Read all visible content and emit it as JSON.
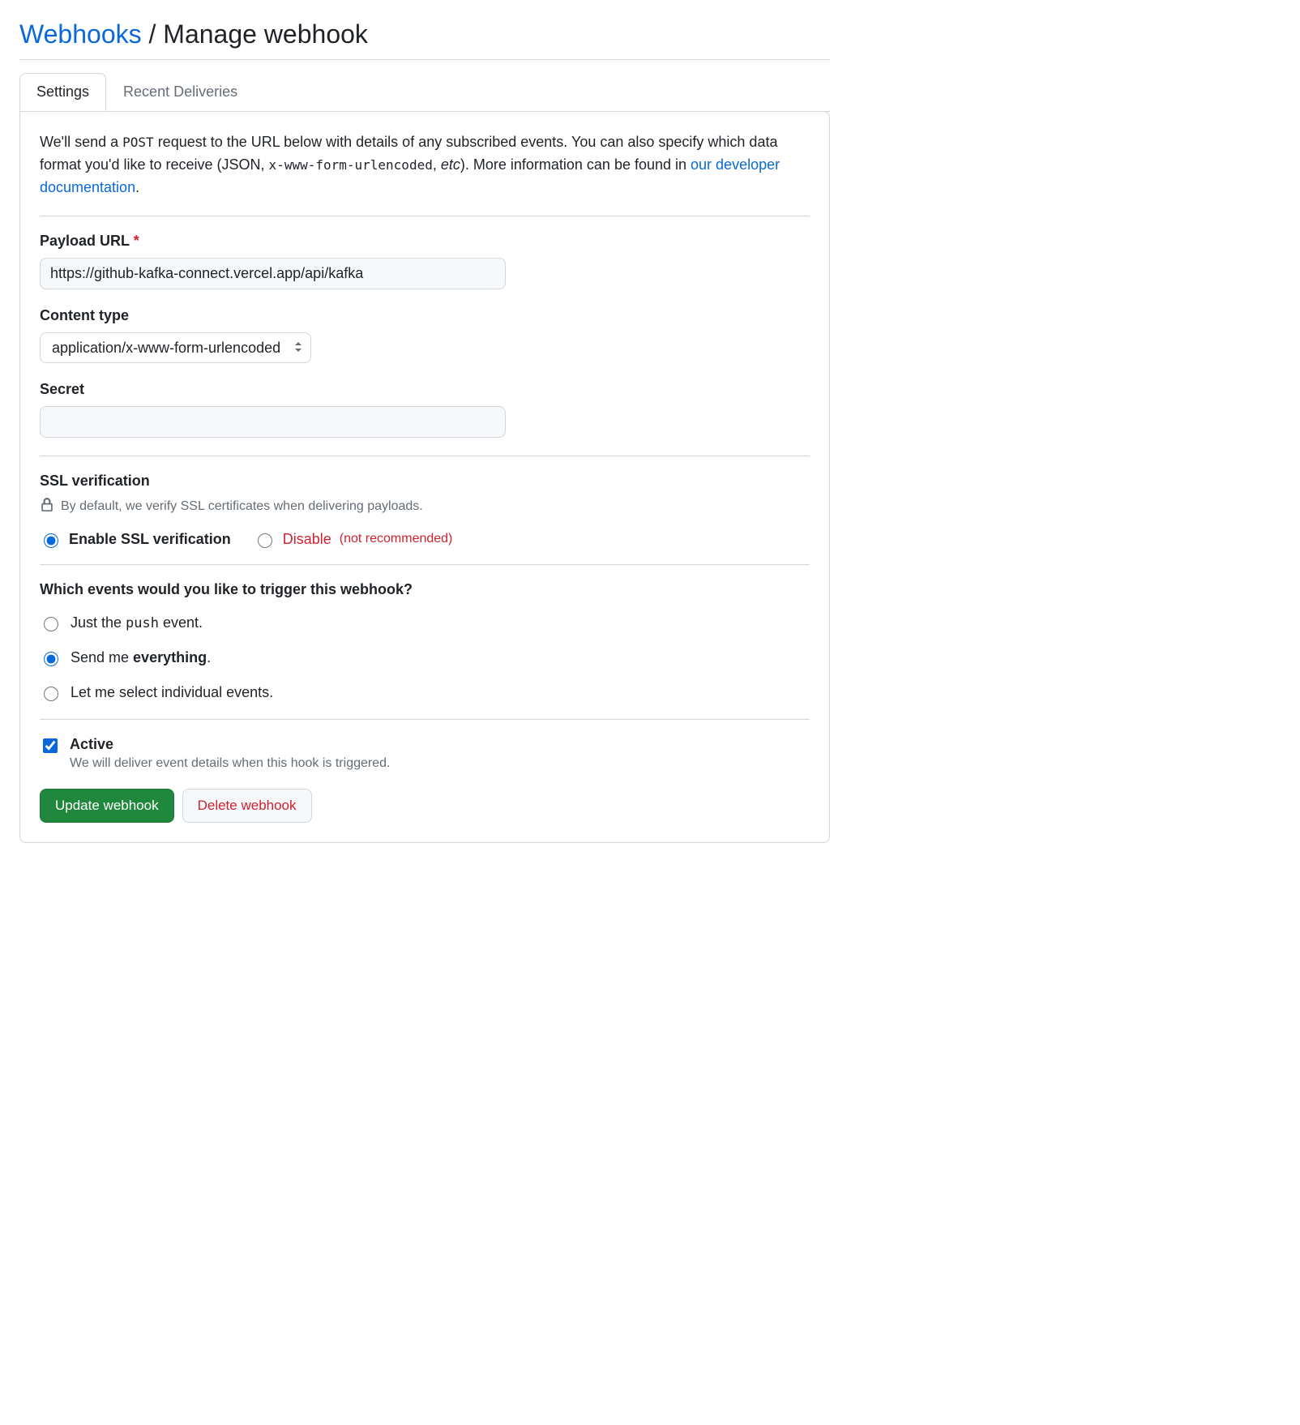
{
  "header": {
    "breadcrumb_link": "Webhooks",
    "separator": " / ",
    "title": "Manage webhook"
  },
  "tabs": {
    "settings": "Settings",
    "deliveries": "Recent Deliveries"
  },
  "intro": {
    "p1a": "We'll send a ",
    "p1_code": "POST",
    "p1b": " request to the URL below with details of any subscribed events. You can also specify which data format you'd like to receive (JSON, ",
    "p1_code2": "x-www-form-urlencoded",
    "p1c": ", ",
    "p1_em": "etc",
    "p1d": "). More information can be found in ",
    "link": "our developer documentation",
    "p1e": "."
  },
  "form": {
    "payload_url_label": "Payload URL",
    "payload_url_value": "https://github-kafka-connect.vercel.app/api/kafka",
    "content_type_label": "Content type",
    "content_type_value": "application/x-www-form-urlencoded",
    "secret_label": "Secret",
    "secret_value": ""
  },
  "ssl": {
    "heading": "SSL verification",
    "note": "By default, we verify SSL certificates when delivering payloads.",
    "enable": "Enable SSL verification",
    "disable": "Disable",
    "disable_note": "(not recommended)"
  },
  "events": {
    "heading": "Which events would you like to trigger this webhook?",
    "opt1a": "Just the ",
    "opt1_code": "push",
    "opt1b": " event.",
    "opt2a": "Send me ",
    "opt2_strong": "everything",
    "opt2b": ".",
    "opt3": "Let me select individual events."
  },
  "active": {
    "label": "Active",
    "note": "We will deliver event details when this hook is triggered."
  },
  "buttons": {
    "update": "Update webhook",
    "delete": "Delete webhook"
  }
}
